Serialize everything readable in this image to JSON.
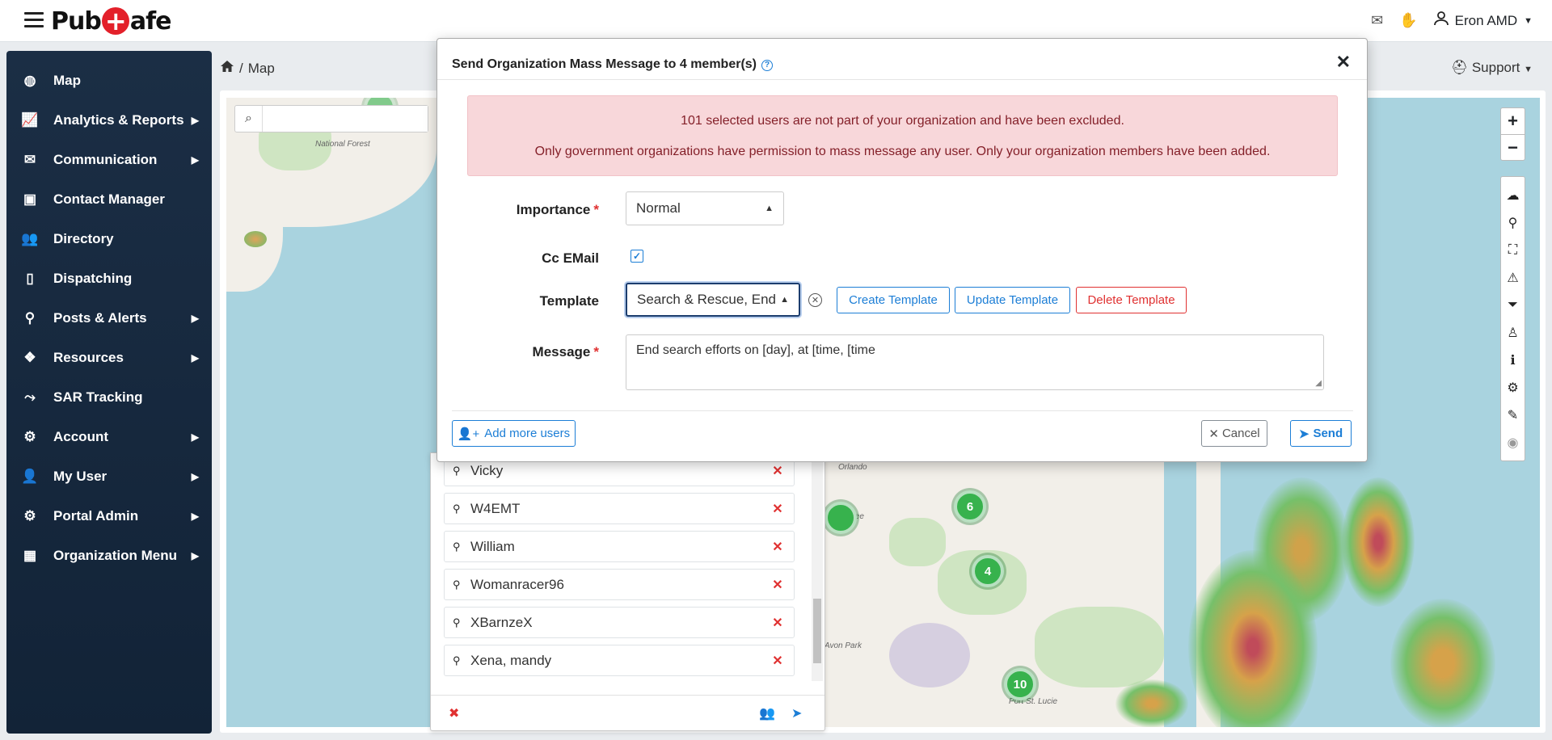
{
  "app": {
    "brand_left": "Pub",
    "brand_cross": "+",
    "brand_right": "afe",
    "user_name": "Eron AMD",
    "support_label": "Support"
  },
  "sidebar": {
    "items": [
      {
        "label": "Map",
        "icon": "globe-icon",
        "submenu": false
      },
      {
        "label": "Analytics & Reports",
        "icon": "chart-icon",
        "submenu": true
      },
      {
        "label": "Communication",
        "icon": "envelope-icon",
        "submenu": true
      },
      {
        "label": "Contact Manager",
        "icon": "address-book-icon",
        "submenu": false
      },
      {
        "label": "Directory",
        "icon": "users-icon",
        "submenu": false
      },
      {
        "label": "Dispatching",
        "icon": "phone-icon",
        "submenu": false
      },
      {
        "label": "Posts & Alerts",
        "icon": "map-marker-icon",
        "submenu": true
      },
      {
        "label": "Resources",
        "icon": "cubes-icon",
        "submenu": true
      },
      {
        "label": "SAR Tracking",
        "icon": "route-icon",
        "submenu": false
      },
      {
        "label": "Account",
        "icon": "gear-icon",
        "submenu": true
      },
      {
        "label": "My User",
        "icon": "user-icon",
        "submenu": true
      },
      {
        "label": "Portal Admin",
        "icon": "cog-icon",
        "submenu": true
      },
      {
        "label": "Organization Menu",
        "icon": "building-icon",
        "submenu": true
      }
    ]
  },
  "breadcrumb": {
    "separator": "/",
    "current": "Map"
  },
  "map": {
    "search_placeholder": "",
    "forest_label": "National Forest",
    "cities": [
      "Orlando",
      "Kissimmee",
      "Avon Park",
      "Port St. Lucie"
    ],
    "clusters": [
      "6",
      "4",
      "10"
    ]
  },
  "modal": {
    "title": "Send Organization Mass Message to 4 member(s)",
    "alert_line1": "101 selected users are not part of your organization and have been excluded.",
    "alert_line2": "Only government organizations have permission to mass message any user. Only your organization members have been added.",
    "importance_label": "Importance",
    "importance_value": "Normal",
    "cc_label": "Cc EMail",
    "cc_checked": true,
    "template_label": "Template",
    "template_value": "Search & Rescue, End",
    "create_template": "Create Template",
    "update_template": "Update Template",
    "delete_template": "Delete Template",
    "message_label": "Message",
    "message_value": "End search efforts on [day], at [time, [time",
    "add_users": "Add more users",
    "cancel": "Cancel",
    "send": "Send"
  },
  "members": [
    "Vicky",
    "W4EMT",
    "William",
    "Womanracer96",
    "XBarnzeX",
    "Xena, mandy"
  ],
  "colors": {
    "sidebar_bg": "#1b2e45",
    "primary": "#1c7ed6",
    "danger": "#e03131",
    "alert_bg": "#f8d7da",
    "cluster_green": "#37b24d"
  }
}
